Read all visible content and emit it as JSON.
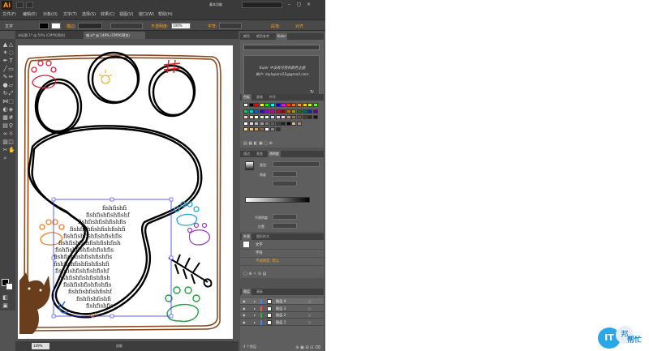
{
  "app": {
    "logo": "Ai",
    "menu": [
      "文件(F)",
      "编辑(E)",
      "对象(O)",
      "文字(T)",
      "选择(S)",
      "效果(C)",
      "视图(V)",
      "窗口(W)",
      "帮助(H)"
    ],
    "workspace": "基本功能"
  },
  "control_bar": {
    "selection_label": "文字",
    "stroke_label": "描边:",
    "opacity_label": "不透明度:",
    "opacity_value": "100%",
    "char_label": "字符:",
    "para_label": "段落:",
    "align_label": "对齐"
  },
  "tabs": [
    {
      "label": "未标题-1* @ 50% (CMYK/预览)",
      "active": false
    },
    {
      "label": "喵.ai* @ 149% (CMYK/预览)",
      "active": true
    }
  ],
  "statusbar": {
    "zoom": "149%",
    "page": "1",
    "status": "选取"
  },
  "artwork": {
    "fish_lines": [
      "fishfishfi",
      "fishfishfishfishf",
      "fishfishfishfishfis",
      "fishfishfishfishfishfi",
      "fishfishfishfishfishfis",
      "fishfishfishfishfishfish",
      "fishfishfishfishfishfis",
      "fishfishfishfishfishfis",
      "fishfishfishfishfishfi",
      "fishfishfishfishfishf",
      "fishfishfishfishfish",
      "fishfishfishfishfis",
      "fishfishfishfishf",
      "fishfishfishfi",
      "fishfishfis"
    ]
  },
  "panels": {
    "kuler": {
      "tabs": [
        "颜色",
        "颜色参考",
        "Kuler"
      ],
      "line1": "Kuler 中没有可用的颜色主题",
      "line2": "帐户: styleparn12@gmail.com"
    },
    "swatches": {
      "tabs": [
        "色板",
        "画笔",
        "符号"
      ]
    },
    "transparency": {
      "tabs": [
        "描边",
        "渐变",
        "透明度"
      ],
      "type_label": "类型:",
      "angle_label": "角度",
      "opacity_label": "不透明度",
      "position_label": "位置"
    },
    "appearance": {
      "tabs": [
        "外观",
        "图形样式"
      ],
      "rows": [
        "文字",
        "字符",
        "不透明度: 默认"
      ]
    },
    "layers": {
      "tabs": [
        "图层",
        "画板"
      ],
      "rows": [
        {
          "name": "图层 4",
          "color": "#4b7bff",
          "selected": true
        },
        {
          "name": "图层 3",
          "color": "#ff4f4f",
          "selected": false
        },
        {
          "name": "图层 2",
          "color": "#3aa84b",
          "selected": false
        },
        {
          "name": "图层 1",
          "color": "#4b7bff",
          "selected": false
        }
      ],
      "count": "4 个图层"
    }
  },
  "watermark": {
    "it": "IT",
    "bang": "邦",
    "bm": "帮忙"
  },
  "colors": {
    "accent_orange": "#f0a030",
    "selection_blue": "#3a3af0",
    "frame_brown": "#8b4a1e"
  }
}
